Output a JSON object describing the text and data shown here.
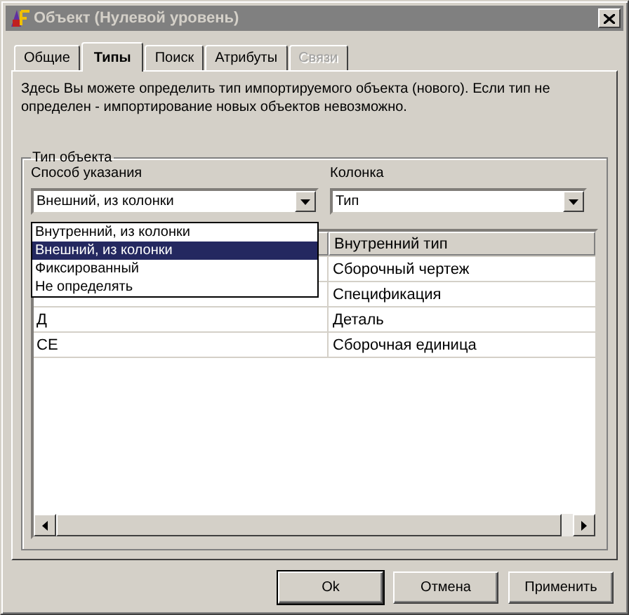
{
  "window": {
    "title": "Объект (Нулевой уровень)"
  },
  "tabs": [
    {
      "label": "Общие",
      "selected": false,
      "disabled": false
    },
    {
      "label": "Типы",
      "selected": true,
      "disabled": false
    },
    {
      "label": "Поиск",
      "selected": false,
      "disabled": false
    },
    {
      "label": "Атрибуты",
      "selected": false,
      "disabled": false
    },
    {
      "label": "Связи",
      "selected": false,
      "disabled": true
    }
  ],
  "description": "Здесь Вы можете определить тип импортируемого объекта (нового). Если тип не определен - импортирование новых объектов невозможно.",
  "group": {
    "title": "Тип объекта",
    "method": {
      "label": "Способ указания",
      "value": "Внешний, из колонки",
      "options": [
        {
          "label": "Внутренний, из колонки",
          "selected": false
        },
        {
          "label": "Внешний, из колонки",
          "selected": true
        },
        {
          "label": "Фиксированный",
          "selected": false
        },
        {
          "label": "Не определять",
          "selected": false
        }
      ]
    },
    "column": {
      "label": "Колонка",
      "value": "Тип"
    },
    "table": {
      "columns": [
        "Внутренний тип"
      ],
      "rows": [
        {
          "internal_type": "Сборочный чертеж"
        },
        {
          "internal_type": "Спецификация"
        },
        {
          "column_1": "Д",
          "internal_type": "Деталь"
        },
        {
          "column_1": "СЕ",
          "internal_type": "Сборочная единица"
        }
      ]
    }
  },
  "buttons": [
    {
      "label": "Ok",
      "default": true
    },
    {
      "label": "Отмена",
      "default": false
    },
    {
      "label": "Применить",
      "default": false
    }
  ]
}
